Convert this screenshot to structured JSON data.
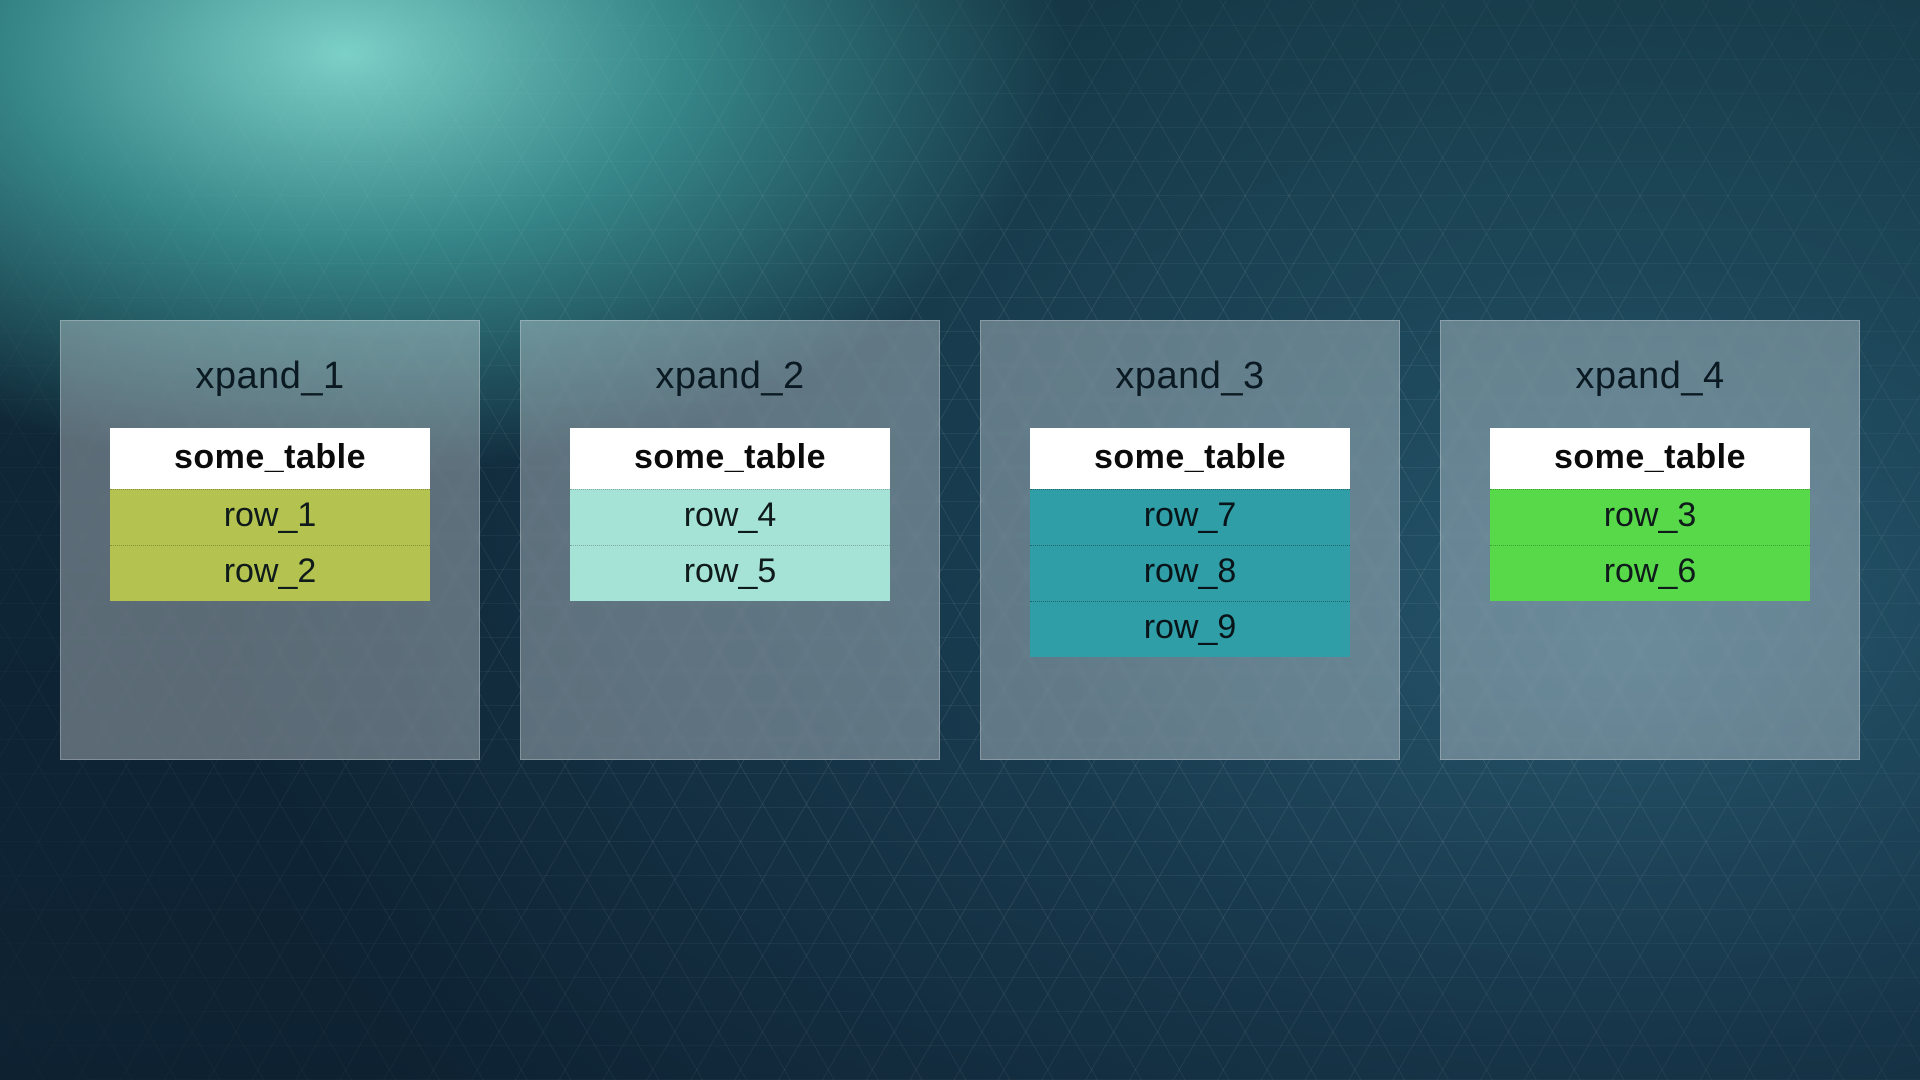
{
  "nodes": [
    {
      "title": "xpand_1",
      "table_name": "some_table",
      "row_color": "olive",
      "rows": [
        "row_1",
        "row_2"
      ]
    },
    {
      "title": "xpand_2",
      "table_name": "some_table",
      "row_color": "mint",
      "rows": [
        "row_4",
        "row_5"
      ]
    },
    {
      "title": "xpand_3",
      "table_name": "some_table",
      "row_color": "teal",
      "rows": [
        "row_7",
        "row_8",
        "row_9"
      ]
    },
    {
      "title": "xpand_4",
      "table_name": "some_table",
      "row_color": "green",
      "rows": [
        "row_3",
        "row_6"
      ]
    }
  ],
  "colors": {
    "olive": "#b4c24f",
    "mint": "#a6e3d7",
    "teal": "#2f9ea6",
    "green": "#57d94a"
  }
}
